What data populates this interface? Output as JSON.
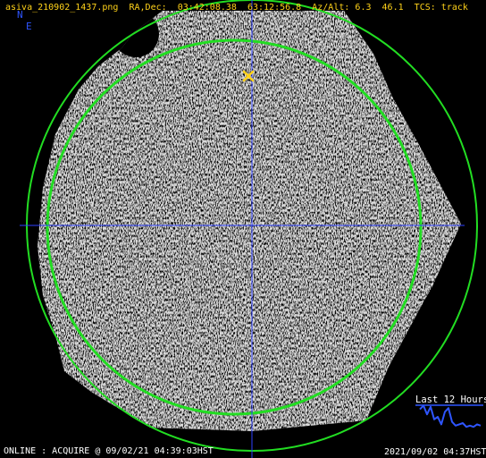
{
  "header": {
    "filename": "asiva_210902_1437.png",
    "radec_label": "RA,Dec:",
    "ra": "03:42:08.38",
    "dec": "63:12:56.8",
    "azalt_label": "Az/Alt:",
    "az": "6.3",
    "alt": "46.1",
    "tcs_label": "TCS:",
    "tcs_value": "track"
  },
  "compass": {
    "north": "N",
    "east": "E"
  },
  "footer": {
    "status": "ONLINE : ACQUIRE @ 09/02/21 04:39:03HST",
    "timestamp": "2021/09/02 04:37HST"
  },
  "history": {
    "label": "Last 12 Hours",
    "values": [
      0.8,
      0.95,
      0.6,
      0.9,
      0.4,
      0.5,
      0.2,
      0.7,
      0.85,
      0.3,
      0.15,
      0.2,
      0.25,
      0.1,
      0.15,
      0.1,
      0.2,
      0.15
    ]
  },
  "colors": {
    "text_yellow": "#ffd21a",
    "compass_blue": "#2e55ff",
    "horizon_ring": "#22dd22",
    "crosshair": "#2e40ff",
    "target_marker": "#ffd21a",
    "sky": "#d8d8d8"
  },
  "icons": {
    "target": "target-x-icon"
  }
}
